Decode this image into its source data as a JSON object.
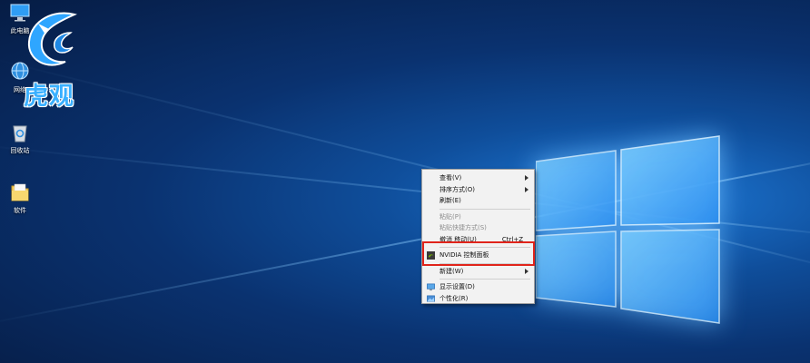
{
  "desktop": {
    "icons": [
      {
        "id": "this-pc",
        "label": "此电脑",
        "icon": "computer-icon"
      },
      {
        "id": "network",
        "label": "网络",
        "icon": "network-icon"
      },
      {
        "id": "recycle-bin",
        "label": "回收站",
        "icon": "recycle-bin-icon"
      },
      {
        "id": "software",
        "label": "软件",
        "icon": "folder-icon"
      }
    ],
    "watermark": {
      "text": "虎观",
      "accent": "#3ab0ff"
    }
  },
  "context_menu": {
    "items": [
      {
        "label": "查看(V)",
        "submenu": true,
        "disabled": false
      },
      {
        "label": "排序方式(O)",
        "submenu": true,
        "disabled": false
      },
      {
        "label": "刷新(E)",
        "disabled": false
      },
      {
        "label": "粘贴(P)",
        "disabled": true
      },
      {
        "label": "粘贴快捷方式(S)",
        "disabled": true
      },
      {
        "label": "撤消 移动(U)",
        "shortcut": "Ctrl+Z",
        "disabled": false
      },
      {
        "label": "NVIDIA 控制面板",
        "icon": "nvidia-icon",
        "disabled": false,
        "highlighted": true
      },
      {
        "label": "新建(W)",
        "submenu": true,
        "disabled": false
      },
      {
        "label": "显示设置(D)",
        "icon": "display-icon",
        "disabled": false
      },
      {
        "label": "个性化(R)",
        "icon": "personalize-icon",
        "disabled": false
      }
    ],
    "highlight_color": "#e0241b"
  },
  "theme": {
    "accent": "#1e7ad8",
    "background": "#0a3270"
  }
}
